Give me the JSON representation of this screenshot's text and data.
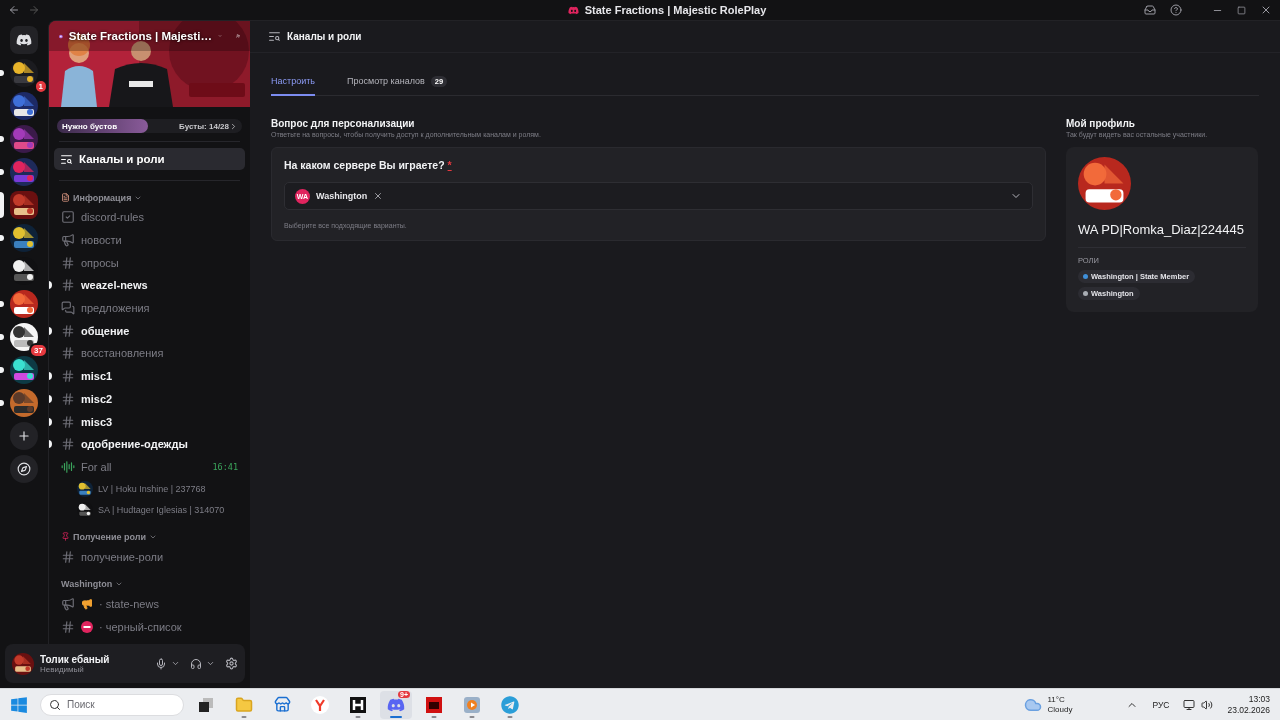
{
  "titlebar": {
    "title": "State Fractions | Majestic RolePlay"
  },
  "servers": [
    {
      "kind": "home",
      "selected": false,
      "unread": false
    },
    {
      "kind": "server",
      "selected": false,
      "unread": true,
      "badge": "1"
    },
    {
      "kind": "server",
      "selected": false,
      "unread": false
    },
    {
      "kind": "server",
      "selected": false,
      "unread": true
    },
    {
      "kind": "server",
      "selected": false,
      "unread": true
    },
    {
      "kind": "server",
      "selected": true,
      "unread": false
    },
    {
      "kind": "server",
      "selected": false,
      "unread": true
    },
    {
      "kind": "server",
      "selected": false,
      "unread": false
    },
    {
      "kind": "server",
      "selected": false,
      "unread": true
    },
    {
      "kind": "server",
      "selected": false,
      "unread": true,
      "badge": "37"
    },
    {
      "kind": "server",
      "selected": false,
      "unread": true
    },
    {
      "kind": "server",
      "selected": false,
      "unread": true
    },
    {
      "kind": "add",
      "selected": false,
      "unread": false
    },
    {
      "kind": "explore",
      "selected": false,
      "unread": false
    }
  ],
  "server": {
    "name": "State Fractions | Majesti…"
  },
  "boost": {
    "label": "Нужно бустов",
    "level": 0.49,
    "count": "Бусты: 14/28"
  },
  "nav": {
    "label": "Каналы и роли",
    "selected": true
  },
  "categories": [
    {
      "name": "Информация",
      "emoji": {
        "kind": "document"
      },
      "channels": [
        {
          "kind": "rules",
          "name": "discord-rules",
          "unread": false
        },
        {
          "kind": "announcement",
          "name": "новости",
          "unread": false
        },
        {
          "kind": "text",
          "name": "опросы",
          "unread": false
        },
        {
          "kind": "text-thread",
          "name": "weazel-news",
          "unread": true
        },
        {
          "kind": "forum",
          "name": "предложения",
          "unread": false
        },
        {
          "kind": "text",
          "name": "общение",
          "unread": true
        },
        {
          "kind": "text",
          "name": "восстановления",
          "unread": false
        },
        {
          "kind": "text",
          "name": "misc1",
          "unread": true
        },
        {
          "kind": "text",
          "name": "misc2",
          "unread": true
        },
        {
          "kind": "text",
          "name": "misc3",
          "unread": true
        },
        {
          "kind": "text",
          "name": "одобрение-одежды",
          "unread": true
        },
        {
          "kind": "voice",
          "name": "For all",
          "unread": false,
          "time": "16:41",
          "members": [
            {
              "name": "LV | Hoku Inshine | 237768"
            },
            {
              "name": "SA | Hudtager Iglesias | 314070"
            }
          ]
        }
      ]
    },
    {
      "name": "Получение роли",
      "emoji": {
        "kind": "pin"
      },
      "channels": [
        {
          "kind": "text",
          "name": "получение-роли",
          "unread": false
        }
      ]
    },
    {
      "name": "Washington",
      "channels": [
        {
          "kind": "announcement",
          "name": "· state-news",
          "unread": false,
          "emoji": {
            "kind": "megaphone"
          }
        },
        {
          "kind": "text-thread",
          "name": "· черный-список",
          "unread": false,
          "emoji": {
            "kind": "no-entry"
          }
        }
      ]
    }
  ],
  "user": {
    "name": "Толик ебаный",
    "status": "Невидимый"
  },
  "header": {
    "title": "Каналы и роли"
  },
  "tabs": [
    {
      "label": "Настроить",
      "selected": true
    },
    {
      "label": "Просмотр каналов",
      "selected": false,
      "count": "29"
    }
  ],
  "onboarding": {
    "title": "Вопрос для персонализации",
    "subtitle": "Ответьте на вопросы, чтобы получить доступ к дополнительным каналам и ролям.",
    "question": {
      "text": "На каком сервере Вы играете?",
      "required_mark": "*",
      "selections": [
        {
          "badge": "WA",
          "label": "Washington"
        }
      ],
      "hint": "Выберите все подходящие варианты."
    }
  },
  "profile": {
    "title": "Мой профиль",
    "subtitle": "Так будут видеть вас остальные участники.",
    "name": "WA PD|Romka_Diaz|224445",
    "roles_label": "РОЛИ",
    "roles": [
      {
        "name": "Washington | State Member",
        "color": "#3f8fd8"
      },
      {
        "name": "Washington",
        "color": "#a9adb4"
      }
    ]
  },
  "taskbar": {
    "search": {
      "placeholder": "Поиск"
    },
    "apps": [
      {
        "kind": "task-view",
        "running": false,
        "selected": false
      },
      {
        "kind": "explorer",
        "running": true,
        "selected": false
      },
      {
        "kind": "store",
        "running": false,
        "selected": false
      },
      {
        "kind": "browser",
        "running": false,
        "selected": false
      },
      {
        "kind": "h-app",
        "running": true,
        "selected": false
      },
      {
        "kind": "discord",
        "running": true,
        "selected": true,
        "badge": "9+"
      },
      {
        "kind": "red-app",
        "running": true,
        "selected": false
      },
      {
        "kind": "media",
        "running": true,
        "selected": false
      },
      {
        "kind": "telegram",
        "running": true,
        "selected": false
      }
    ],
    "weather": {
      "temp": "11°C",
      "condition": "Cloudy"
    },
    "language": "РУС",
    "time": "13:03",
    "date": "23.02.2026"
  }
}
